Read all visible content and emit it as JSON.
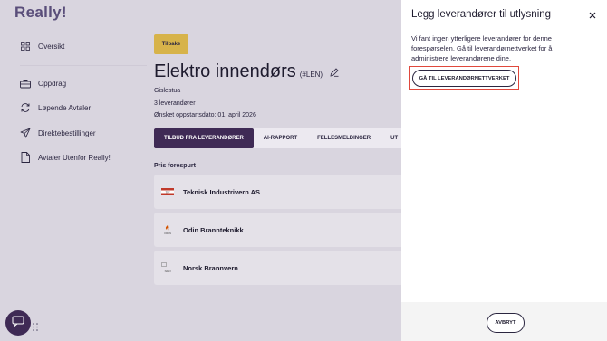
{
  "app": {
    "logo": "Really!"
  },
  "nav": {
    "items": [
      {
        "label": "Oversikt",
        "icon": "grid-icon"
      },
      {
        "label": "Oppdrag",
        "icon": "briefcase-icon"
      },
      {
        "label": "Løpende Avtaler",
        "icon": "refresh-icon"
      },
      {
        "label": "Direktebestillinger",
        "icon": "send-icon"
      },
      {
        "label": "Avtaler Utenfor Really!",
        "icon": "document-icon"
      }
    ]
  },
  "main": {
    "back_label": "Tilbake",
    "title": "Elektro innendørs",
    "title_tag": "(#LEN)",
    "location": "Gislestua",
    "supplier_count": "3 leverandører",
    "start_date": "Ønsket oppstartsdato: 01. april 2026",
    "tabs": [
      {
        "label": "TILBUD FRA LEVERANDØRER",
        "active": true
      },
      {
        "label": "AI-RAPPORT",
        "active": false
      },
      {
        "label": "FELLESMELDINGER",
        "active": false
      },
      {
        "label": "UT",
        "active": false
      }
    ],
    "section_title": "Pris forespurt",
    "suppliers": [
      {
        "name": "Teknisk Industrivern AS",
        "logo_text": "TIV"
      },
      {
        "name": "Odin Brannteknikk",
        "logo_text": "ODIN"
      },
      {
        "name": "Norsk Brannvern",
        "logo_text": "Sup"
      }
    ]
  },
  "drawer": {
    "title": "Legg leverandører til utlysning",
    "text": "Vi fant ingen ytterligere leverandører for denne forespørselen. Gå til leverandørnettverket for å administrere leverandørene dine.",
    "go_button": "GÅ TIL LEVERANDØRNETTVERKET",
    "cancel_button": "AVBRYT"
  },
  "colors": {
    "accent": "#3f2a55",
    "back_button": "#d7b34a",
    "highlight": "#e0483c"
  }
}
